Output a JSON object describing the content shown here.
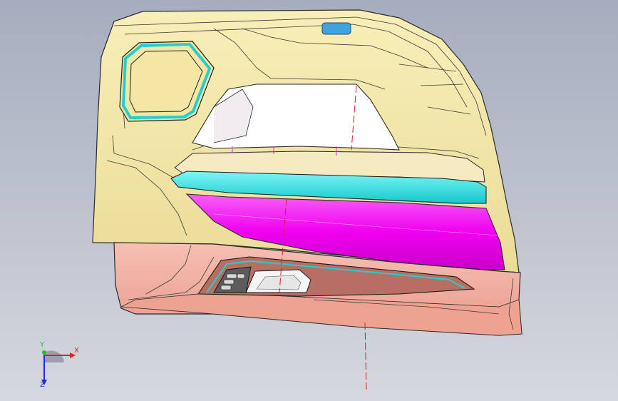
{
  "viewport": {
    "background_top": "#a6adbe",
    "background_bottom": "#d6d8df"
  },
  "model": {
    "colors": {
      "upper_trim": "#f4e7a6",
      "lower_trim": "#f2b0a2",
      "armrest_band": "#20e6e6",
      "insert_panel": "#f000f0",
      "map_pocket": "#b86f63",
      "switch_bezel": "#6a6a6a",
      "handle_cap": "#3fa3e0",
      "edge_lines": "#2a2a2a",
      "axis_line": "#d0202a"
    }
  },
  "triad": {
    "x_label": "X",
    "y_label": "Y",
    "z_label": "Z",
    "x_color": "#e02020",
    "y_color": "#20c020",
    "z_color": "#2030e0"
  }
}
